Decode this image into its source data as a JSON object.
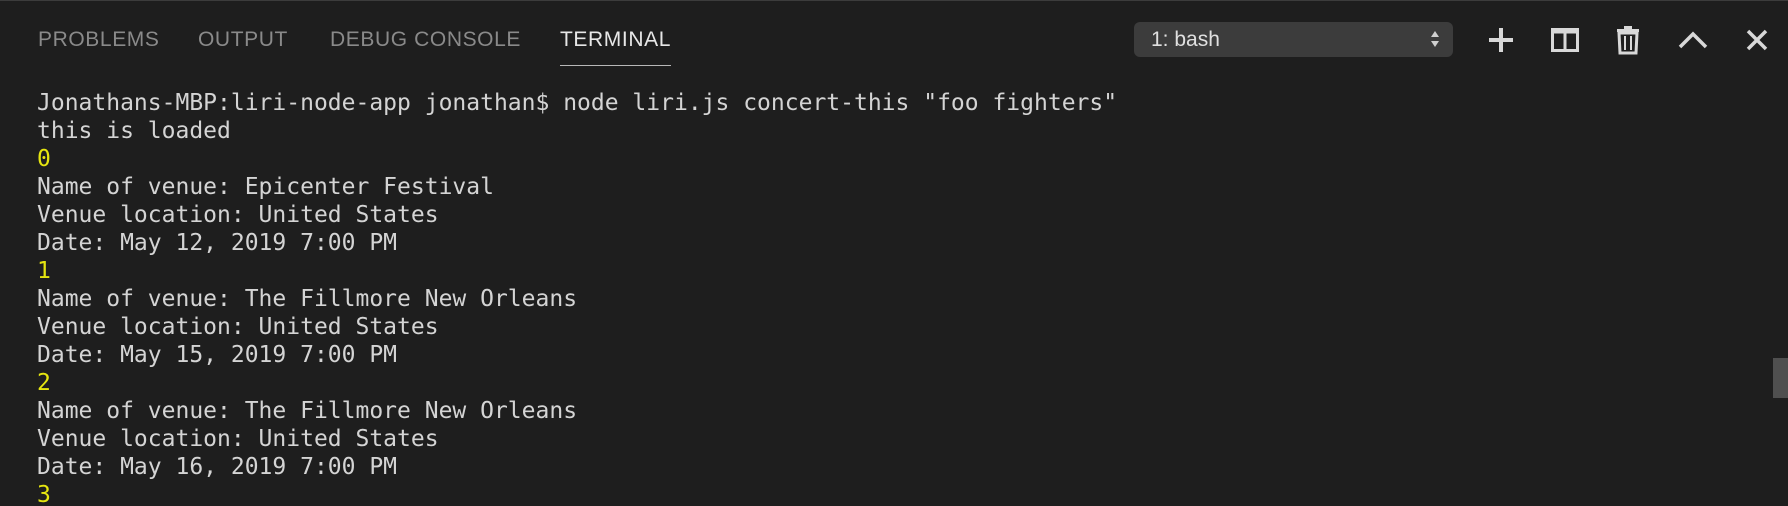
{
  "tabs": [
    {
      "label": "PROBLEMS",
      "active": false
    },
    {
      "label": "OUTPUT",
      "active": false
    },
    {
      "label": "DEBUG CONSOLE",
      "active": false
    },
    {
      "label": "TERMINAL",
      "active": true
    }
  ],
  "terminal_selector": {
    "value": "1: bash"
  },
  "toolbar_icons": [
    "plus-icon",
    "split-icon",
    "trash-icon",
    "chevron-up-icon",
    "close-icon"
  ],
  "terminal": {
    "lines": [
      {
        "text": "Jonathans-MBP:liri-node-app jonathan$ node liri.js concert-this \"foo fighters\"",
        "color": "#d4d4d4"
      },
      {
        "text": "this is loaded",
        "color": "#d4d4d4"
      },
      {
        "text": "0",
        "color": "#e5e510"
      },
      {
        "text": "Name of venue: Epicenter Festival",
        "color": "#d4d4d4"
      },
      {
        "text": "Venue location: United States",
        "color": "#d4d4d4"
      },
      {
        "text": "Date: May 12, 2019 7:00 PM",
        "color": "#d4d4d4"
      },
      {
        "text": "1",
        "color": "#e5e510"
      },
      {
        "text": "Name of venue: The Fillmore New Orleans",
        "color": "#d4d4d4"
      },
      {
        "text": "Venue location: United States",
        "color": "#d4d4d4"
      },
      {
        "text": "Date: May 15, 2019 7:00 PM",
        "color": "#d4d4d4"
      },
      {
        "text": "2",
        "color": "#e5e510"
      },
      {
        "text": "Name of venue: The Fillmore New Orleans",
        "color": "#d4d4d4"
      },
      {
        "text": "Venue location: United States",
        "color": "#d4d4d4"
      },
      {
        "text": "Date: May 16, 2019 7:00 PM",
        "color": "#d4d4d4"
      },
      {
        "text": "3",
        "color": "#e5e510"
      }
    ]
  },
  "colors": {
    "background": "#1e1e1e",
    "text": "#d4d4d4",
    "index_yellow": "#e5e510",
    "tab_inactive": "#8a8a8a",
    "tab_active": "#e7e7e7"
  }
}
